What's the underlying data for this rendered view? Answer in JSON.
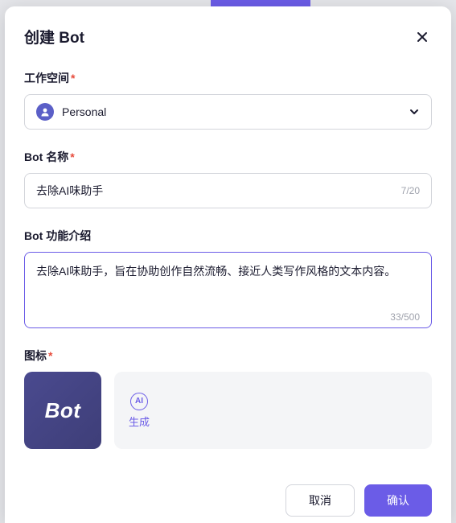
{
  "modal": {
    "title": "创建 Bot"
  },
  "fields": {
    "workspace": {
      "label": "工作空间",
      "value": "Personal"
    },
    "name": {
      "label": "Bot 名称",
      "value": "去除AI味助手",
      "count": "7/20"
    },
    "description": {
      "label": "Bot 功能介绍",
      "value": "去除AI味助手，旨在协助创作自然流畅、接近人类写作风格的文本内容。",
      "count": "33/500"
    },
    "icon": {
      "label": "图标",
      "preview_text": "Bot",
      "generate_label": "生成",
      "generate_icon_text": "AI"
    }
  },
  "footer": {
    "cancel": "取消",
    "confirm": "确认"
  }
}
